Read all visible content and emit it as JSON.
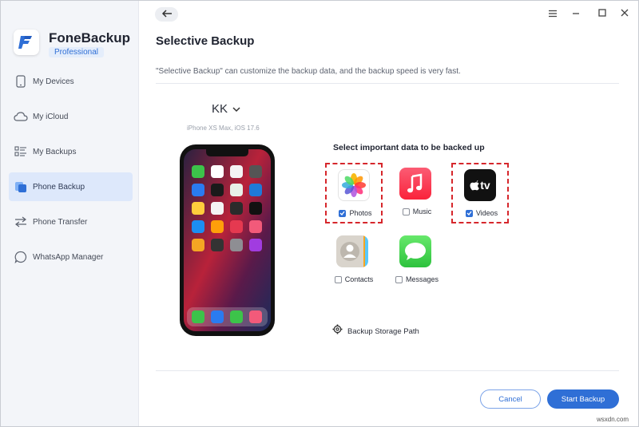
{
  "app": {
    "name": "FoneBackup",
    "edition": "Professional",
    "logo_letter": "F",
    "accent_color": "#2f6fd6"
  },
  "sidebar": {
    "items": [
      {
        "label": "My Devices",
        "icon": "phone-icon",
        "active": false
      },
      {
        "label": "My iCloud",
        "icon": "cloud-icon",
        "active": false
      },
      {
        "label": "My Backups",
        "icon": "backups-list-icon",
        "active": false
      },
      {
        "label": "Phone Backup",
        "icon": "phone-backup-icon",
        "active": true
      },
      {
        "label": "Phone Transfer",
        "icon": "transfer-arrows-icon",
        "active": false
      },
      {
        "label": "WhatsApp Manager",
        "icon": "chat-bubble-icon",
        "active": false
      }
    ]
  },
  "window_controls": [
    "menu-icon",
    "minimize-icon",
    "maximize-icon",
    "close-icon"
  ],
  "page": {
    "title": "Selective Backup",
    "subtitle": "\"Selective Backup\" can customize the backup data, and the backup speed is very fast."
  },
  "device": {
    "name": "KK",
    "model": "iPhone XS Max, iOS 17.6"
  },
  "data_section": {
    "title": "Select important data to be backed up",
    "items": [
      {
        "label": "Photos",
        "icon": "photos-icon",
        "checked": true,
        "highlighted": true
      },
      {
        "label": "Music",
        "icon": "music-icon",
        "checked": false,
        "highlighted": false
      },
      {
        "label": "Videos",
        "icon": "apple-tv-icon",
        "checked": true,
        "highlighted": true
      },
      {
        "label": "Contacts",
        "icon": "contacts-icon",
        "checked": false,
        "highlighted": false
      },
      {
        "label": "Messages",
        "icon": "messages-icon",
        "checked": false,
        "highlighted": false
      }
    ],
    "tv_icon_text": "tv"
  },
  "storage_path": {
    "label": "Backup Storage Path"
  },
  "buttons": {
    "cancel": "Cancel",
    "start": "Start Backup"
  },
  "watermark": "wsxdn.com"
}
